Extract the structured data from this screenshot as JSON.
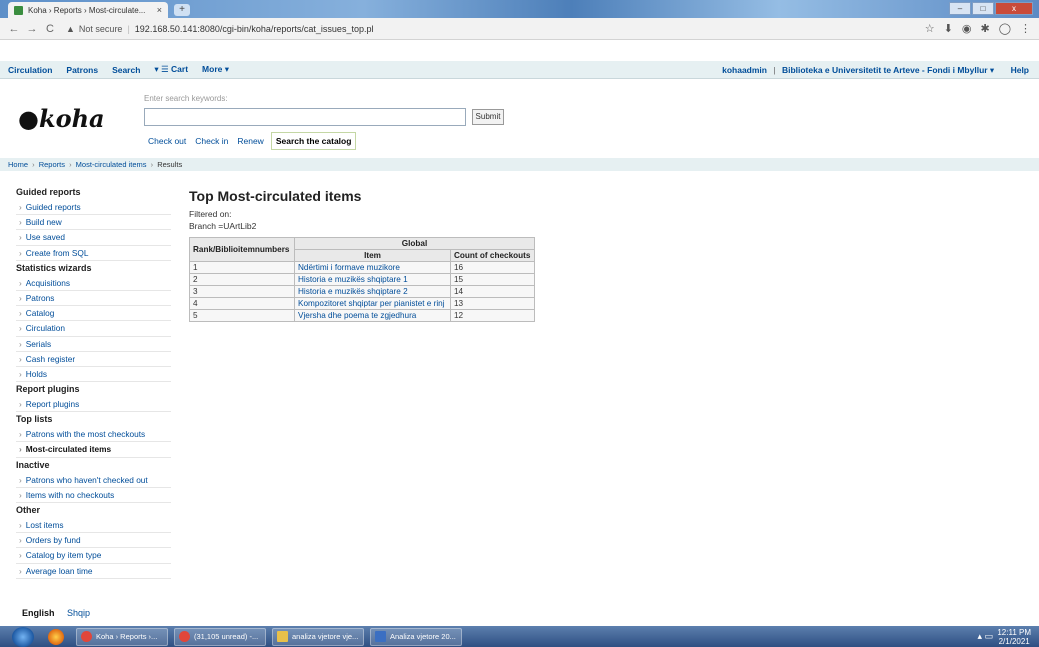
{
  "browser": {
    "tab_title": "Koha › Reports › Most-circulate...",
    "tab_close": "×",
    "new_tab": "+",
    "window_controls": [
      "–",
      "□",
      "x"
    ],
    "nav": {
      "back": "←",
      "forward": "→",
      "reload": "C"
    },
    "security_label": "Not secure",
    "url": "192.168.50.141:8080/cgi-bin/koha/reports/cat_issues_top.pl",
    "ext_icons": [
      "☆",
      "⬇",
      "◉",
      "✱",
      "◯",
      "⋮"
    ]
  },
  "navbar": {
    "items": [
      "Circulation",
      "Patrons",
      "Search",
      "▾ ☰ Cart",
      "More ▾"
    ],
    "user": "kohaadmin",
    "separator": "|",
    "library": "Biblioteka e Universitetit te Arteve - Fondi i Mbyllur ▾",
    "help": "Help"
  },
  "header": {
    "logo_text": "koha",
    "search_label": "Enter search keywords:",
    "search_value": "",
    "submit_label": "Submit",
    "tabs": [
      "Check out",
      "Check in",
      "Renew",
      "Search the catalog"
    ]
  },
  "breadcrumb": {
    "items": [
      "Home",
      "Reports",
      "Most-circulated items"
    ],
    "current": "Results",
    "separator": "›"
  },
  "sidebar": {
    "sections": [
      {
        "heading": "Guided reports",
        "items": [
          "Guided reports",
          "Build new",
          "Use saved",
          "Create from SQL"
        ]
      },
      {
        "heading": "Statistics wizards",
        "items": [
          "Acquisitions",
          "Patrons",
          "Catalog",
          "Circulation",
          "Serials",
          "Cash register",
          "Holds"
        ]
      },
      {
        "heading": "Report plugins",
        "items": [
          "Report plugins"
        ]
      },
      {
        "heading": "Top lists",
        "items": [
          "Patrons with the most checkouts",
          "Most-circulated items"
        ]
      },
      {
        "heading": "Inactive",
        "items": [
          "Patrons who haven't checked out",
          "Items with no checkouts"
        ]
      },
      {
        "heading": "Other",
        "items": [
          "Lost items",
          "Orders by fund",
          "Catalog by item type",
          "Average loan time"
        ]
      }
    ],
    "current_item": "Most-circulated items"
  },
  "languages": {
    "current": "English",
    "other": "Shqip"
  },
  "main": {
    "title": "Top Most-circulated items",
    "filtered_on": "Filtered on:",
    "filter": "Branch =UArtLib2",
    "table": {
      "header_rank": "Rank/Biblioitemnumbers",
      "header_group": "Global",
      "header_item": "Item",
      "header_count": "Count of checkouts",
      "rows": [
        {
          "rank": "1",
          "item": "Ndërtimi i formave muzikore",
          "count": "16"
        },
        {
          "rank": "2",
          "item": "Historia e muzikës shqiptare 1",
          "count": "15"
        },
        {
          "rank": "3",
          "item": "Historia e muzikës shqiptare 2",
          "count": "14"
        },
        {
          "rank": "4",
          "item": "Kompozitoret shqiptar per pianistet e rinj",
          "count": "13"
        },
        {
          "rank": "5",
          "item": "Vjersha dhe poema te zgjedhura",
          "count": "12"
        }
      ]
    }
  },
  "taskbar": {
    "buttons": [
      "Koha › Reports ›...",
      "(31,105 unread) -...",
      "analiza vjetore vje...",
      "Analiza vjetore 20..."
    ],
    "time": "12:11 PM",
    "date": "2/1/2021",
    "colors": {
      "chrome": "#e8eef6",
      "start": "#1e5aa4"
    }
  }
}
